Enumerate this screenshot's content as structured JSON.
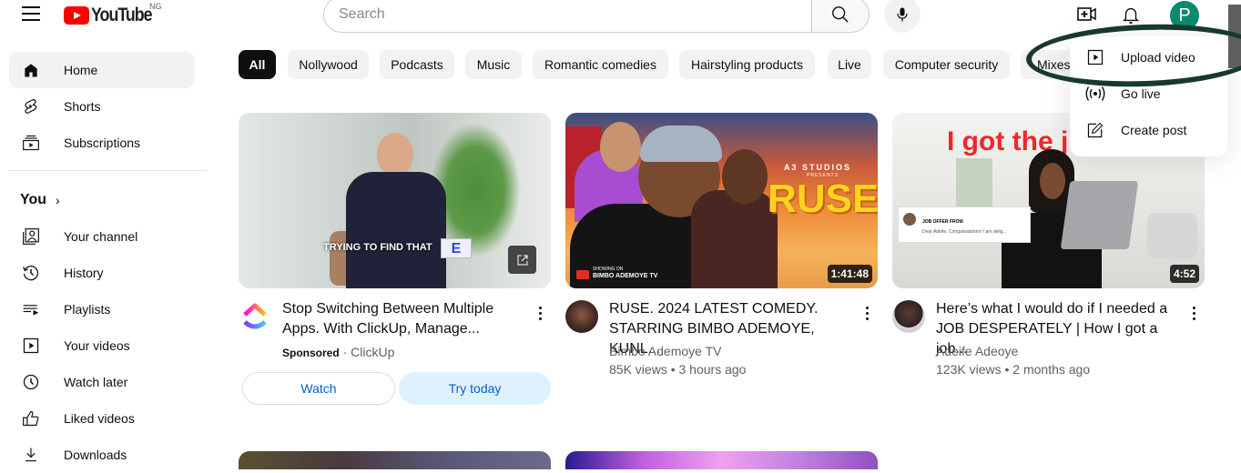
{
  "header": {
    "logo_text": "YouTube",
    "country_code": "NG",
    "search_placeholder": "Search",
    "avatar_letter": "P"
  },
  "sidebar": {
    "items": [
      {
        "label": "Home",
        "icon": "home-icon",
        "active": true
      },
      {
        "label": "Shorts",
        "icon": "shorts-icon"
      },
      {
        "label": "Subscriptions",
        "icon": "subscriptions-icon"
      }
    ],
    "you_section": {
      "title": "You",
      "items": [
        {
          "label": "Your channel",
          "icon": "your-channel-icon"
        },
        {
          "label": "History",
          "icon": "history-icon"
        },
        {
          "label": "Playlists",
          "icon": "playlists-icon"
        },
        {
          "label": "Your videos",
          "icon": "your-videos-icon"
        },
        {
          "label": "Watch later",
          "icon": "watch-later-icon"
        },
        {
          "label": "Liked videos",
          "icon": "liked-videos-icon"
        },
        {
          "label": "Downloads",
          "icon": "downloads-icon"
        }
      ]
    }
  },
  "chips": [
    "All",
    "Nollywood",
    "Podcasts",
    "Music",
    "Romantic comedies",
    "Hairstyling products",
    "Live",
    "Computer security",
    "Mixes"
  ],
  "videos": [
    {
      "title": "Stop Switching Between Multiple Apps. With ClickUp, Manage...",
      "sponsored_label": "Sponsored",
      "channel": "ClickUp",
      "thumb_caption": "TRYING TO FIND THAT",
      "buttons": {
        "watch": "Watch",
        "try": "Try today"
      }
    },
    {
      "title": "RUSE. 2024 LATEST COMEDY. STARRING BIMBO ADEMOYE, KUNL...",
      "channel": "Bimbo Ademoye TV",
      "views": "85K views",
      "age": "3 hours ago",
      "duration": "1:41:48",
      "thumb_text": {
        "studio": "A3 STUDIOS",
        "presents": "PRESENTS",
        "title": "RUSE",
        "showing_on": "SHOWING ON",
        "channel": "BIMBO ADEMOYE TV"
      }
    },
    {
      "title": "Here’s what I would do if I needed a JOB DESPERATELY | How I got a job...",
      "channel": "Adeife Adeoye",
      "views": "123K views",
      "age": "2 months ago",
      "duration": "4:52",
      "thumb_text": {
        "headline": "I got the j",
        "email_subject": "JOB OFFER FROM",
        "email_body": "Dear Adeife, Congratulations! I am delig..."
      }
    }
  ],
  "create_menu": {
    "items": [
      {
        "label": "Upload video",
        "icon": "upload-video-icon"
      },
      {
        "label": "Go live",
        "icon": "go-live-icon"
      },
      {
        "label": "Create post",
        "icon": "create-post-icon"
      }
    ]
  },
  "colors": {
    "brand_red": "#ff0000",
    "avatar_bg": "#0b8a6e",
    "link_blue": "#065fd4",
    "annotation": "#173a2c"
  }
}
